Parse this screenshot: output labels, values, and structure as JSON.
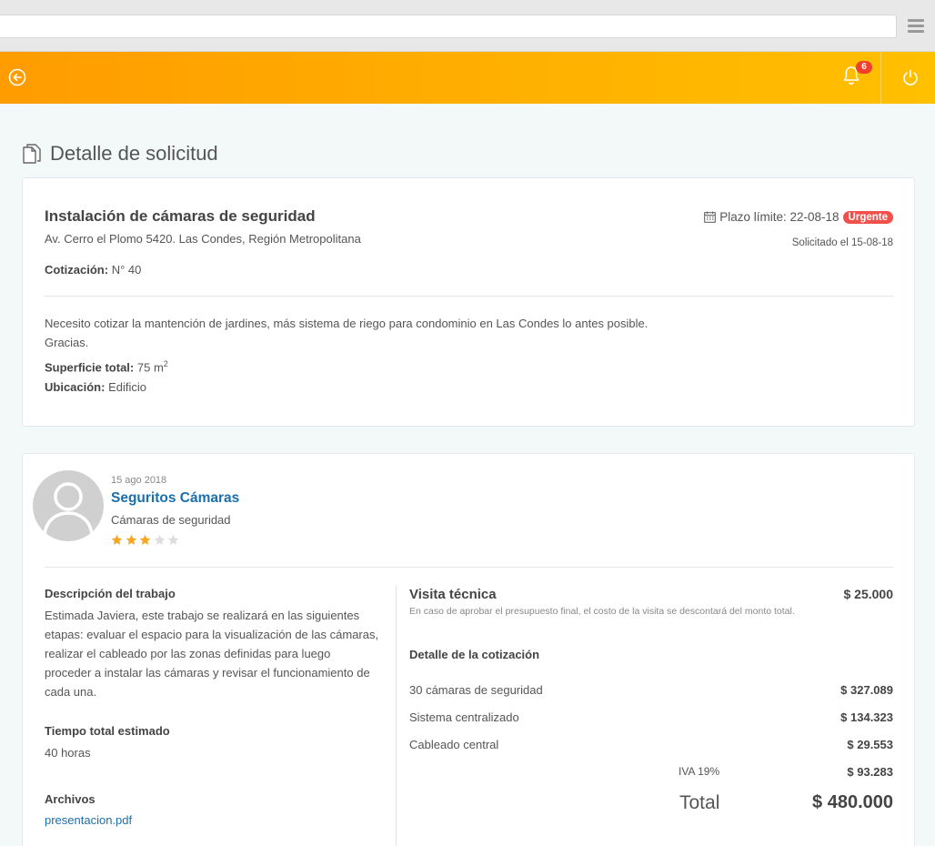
{
  "header": {
    "notifications_count": "6"
  },
  "page": {
    "title": "Detalle de solicitud"
  },
  "request": {
    "title": "Instalación de cámaras de seguridad",
    "address": "Av. Cerro el Plomo 5420. Las Condes, Región Metropolitana",
    "quote_label": "Cotización:",
    "quote_value": "N° 40",
    "deadline_label": "Plazo límite: 22-08-18",
    "urgent_label": "Urgente",
    "requested_label": "Solicitado el 15-08-18",
    "description_line1": "Necesito cotizar la mantención de jardines, más sistema de riego para condominio en Las Condes lo antes posible.",
    "description_line2": "Gracias.",
    "area_label": "Superficie total:",
    "area_value": "75 m",
    "area_sup": "2",
    "location_label": "Ubicación:",
    "location_value": "Edificio"
  },
  "provider": {
    "date": "15 ago 2018",
    "name": "Seguritos Cámaras",
    "category": "Cámaras de seguridad",
    "rating": 3,
    "rating_max": 5,
    "colors": {
      "star_on": "#f5a623",
      "star_off": "#dddddd"
    }
  },
  "work": {
    "description_heading": "Descripción del trabajo",
    "description": "Estimada Javiera, este trabajo se realizará en las siguientes etapas: evaluar el espacio para la visualización de las cámaras, realizar el cableado por las zonas definidas para luego proceder a instalar las cámaras y revisar el funcionamiento de cada una.",
    "time_heading": "Tiempo total estimado",
    "time_value": "40 horas",
    "files_heading": "Archivos",
    "file_name": "presentacion.pdf"
  },
  "quote": {
    "visit_title": "Visita técnica",
    "visit_price": "$ 25.000",
    "visit_note": "En caso de aprobar el presupuesto final, el costo de la visita se descontará del monto total.",
    "detail_heading": "Detalle de la cotización",
    "items": [
      {
        "label": "30 cámaras de seguridad",
        "value": "$ 327.089"
      },
      {
        "label": "Sistema centralizado",
        "value": "$ 134.323"
      },
      {
        "label": "Cableado central",
        "value": "$ 29.553"
      }
    ],
    "iva_label": "IVA 19%",
    "iva_value": "$ 93.283",
    "total_label": "Total",
    "total_value": "$ 480.000"
  },
  "colors": {
    "accent_orange": "#ffa800",
    "link_blue": "#1a6faf",
    "urgent_red": "#f2504b",
    "badge_red": "#f0402c"
  },
  "icons": [
    "menu-icon",
    "back-arrow-icon",
    "bell-icon",
    "power-icon",
    "document-icon",
    "calendar-icon",
    "avatar-placeholder",
    "star-icon"
  ]
}
